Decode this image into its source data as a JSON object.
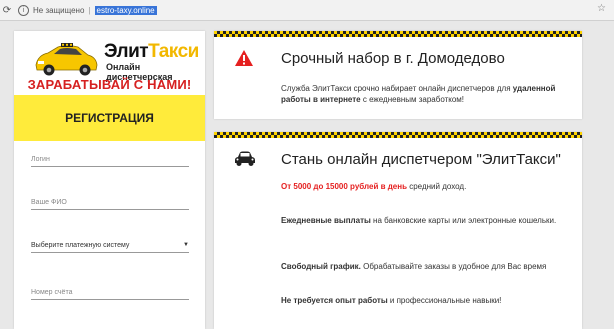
{
  "browser": {
    "security_label": "Не защищено",
    "url": "estro-taxy.online"
  },
  "sidebar": {
    "brand_part1": "Элит",
    "brand_part2": "Такси",
    "brand_sub": "Онлайн диспетчерская",
    "slogan": "ЗАРАБАТЫВАЙ С НАМИ!",
    "register_label": "РЕГИСТРАЦИЯ",
    "fields": {
      "login_placeholder": "Логин",
      "fio_placeholder": "Ваше ФИО",
      "payment_select": "Выберите платежную систему",
      "account_placeholder": "Номер счёта"
    }
  },
  "cards": {
    "urgent": {
      "icon": "warning-icon",
      "title": "Срочный набор в г. Домодедово",
      "text_1": "Служба ЭлитТакси срочно набирает онлайн диспетчеров для ",
      "text_bold": "удаленной работы в интернете",
      "text_2": " с ежедневным заработком!"
    },
    "become": {
      "icon": "car-icon",
      "title": "Стань онлайн диспетчером \"ЭлитТакси\"",
      "income_red": "От 5000 до 15000 рублей в день",
      "income_rest": " средний доход.",
      "payouts_bold": "Ежедневные выплаты",
      "payouts_rest": " на банковские карты или электронные кошельки.",
      "schedule_bold": "Свободный график.",
      "schedule_rest": " Обрабатывайте заказы в удобное для Вас время",
      "experience_bold": "Не требуется опыт работы",
      "experience_rest": " и профессиональные навыки!"
    }
  },
  "colors": {
    "accent_yellow": "#ffeb3b",
    "slogan_red": "#d62020",
    "warning_red": "#e52020"
  }
}
